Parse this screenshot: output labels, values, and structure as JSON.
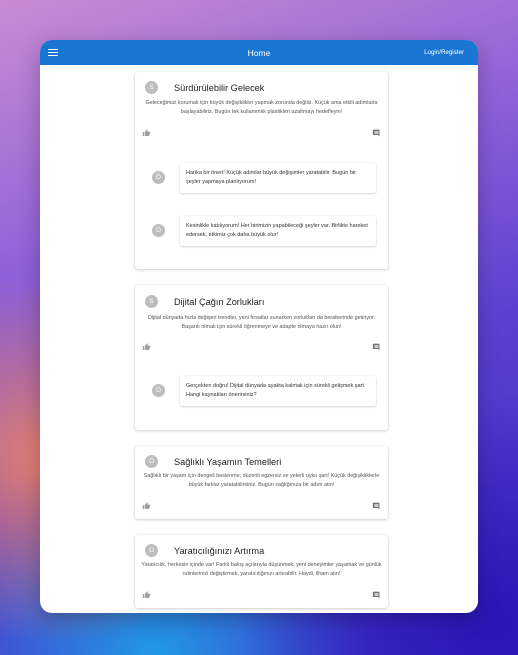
{
  "appbar": {
    "title": "Home",
    "login_label": "Login/Register"
  },
  "icons": {
    "menu": "menu-icon",
    "like": "thumb-up-icon",
    "comment": "comment-icon"
  },
  "colors": {
    "appbar": "#1976d2",
    "avatar": "#bdbdbd"
  },
  "posts": [
    {
      "avatar": "S",
      "title": "Sürdürülebilir Gelecek",
      "body": "Geleceğimizi korumak için büyük değişiklikler yapmak zorunda değiliz. Küçük ama etkili adımlarla başlayabiliriz. Bugün tek kullanımlık plastikleri azaltmayı hedefleyin!",
      "comments": [
        {
          "avatar": "Ö",
          "text": "Harika bir öneri! Küçük adımlar büyük değişimler yaratabilir. Bugün bir şeyler yapmaya planlıyorum!"
        },
        {
          "avatar": "Ö",
          "text": "Kesinlikle katılıyorum! Her birimizin yapabileceği şeyler var. Birlikte hareket edersek, etkimiz çok daha büyük olur!"
        }
      ]
    },
    {
      "avatar": "S",
      "title": "Dijital Çağın Zorlukları",
      "body": "Dijital dünyada hızla değişen trendler, yeni fırsatlar sunarken zorlukları da beraberinde getiriyor. Başarılı olmak için sürekli öğrenmeye ve adapte olmaya hazır olun!",
      "comments": [
        {
          "avatar": "Ö",
          "text": "Gerçekten doğru! Dijital dünyada ayakta kalmak için sürekli gelişmek şart. Hangi kaynakları önerirsiniz?"
        }
      ]
    },
    {
      "avatar": "Ö",
      "title": "Sağlıklı Yaşamın Temelleri",
      "body": "Sağlıklı bir yaşam için dengeli beslenme, düzenli egzersiz ve yeterli uyku şart! Küçük değişikliklerle büyük farklar yaratabilirsiniz. Bugün sağlığınıza bir adım atın!",
      "comments": []
    },
    {
      "avatar": "O",
      "title": "Yaratıcılığınızı Artırma",
      "body": "Yaratıcılık, herkesin içinde var! Farklı bakış açılarıyla düşünmek, yeni deneyimler yaşamak ve günlük rutinlerinizi değiştirmek, yaratıcılığınızı artırabilir. Haydi, ilham alın!",
      "comments": []
    }
  ]
}
